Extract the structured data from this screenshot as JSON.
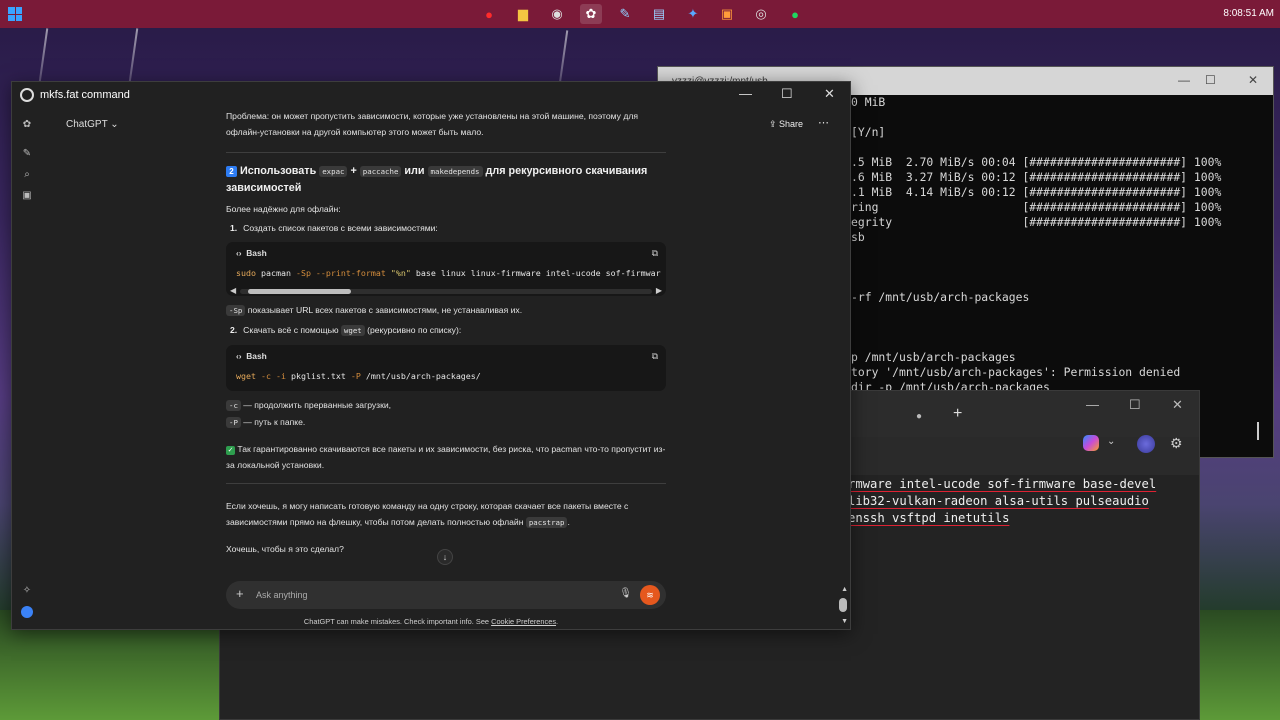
{
  "taskbar": {
    "clock": "8:08:51 AM",
    "icons": [
      "opera-icon",
      "files-icon",
      "obs-icon",
      "chatgpt-icon",
      "paint-icon",
      "notes-icon",
      "vs-icon",
      "office-icon",
      "chrome-icon",
      "spotify-icon"
    ]
  },
  "terminal1": {
    "title": "vzzzi@vzzzi:/mnt/usb",
    "lines": [
      "0 MiB",
      "",
      "[Y/n]",
      "",
      ".5 MiB  2.70 MiB/s 00:04 [######################] 100%",
      ".6 MiB  3.27 MiB/s 00:12 [######################] 100%",
      ".1 MiB  4.14 MiB/s 00:12 [######################] 100%",
      "ring                     [######################] 100%",
      "egrity                   [######################] 100%",
      "sb",
      "",
      "",
      "",
      "-rf /mnt/usb/arch-packages",
      "",
      "",
      "",
      "p /mnt/usb/arch-packages",
      "tory '/mnt/usb/arch-packages': Permission denied",
      "dir -p /mnt/usb/arch-packages"
    ]
  },
  "terminal2": {
    "lines": [
      "rmware intel-ucode sof-firmware base-devel",
      "lib32-vulkan-radeon alsa-utils pulseaudio",
      "enssh vsftpd inetutils"
    ]
  },
  "chatgpt": {
    "window_title": "mkfs.fat command",
    "model": "ChatGPT",
    "share_label": "Share",
    "top_text": "Проблема: он может пропустить зависимости, которые уже установлены на этой машине, поэтому для офлайн-установки на другой компьютер этого может быть мало.",
    "section_num": "2",
    "section_title_pre": "Использовать",
    "section_code1": "expac",
    "section_plus": "+",
    "section_code2": "paccache",
    "section_or": "или",
    "section_code3": "makedepends",
    "section_title_post": "для рекурсивного скачивания зависимостей",
    "reliable": "Более надёжно для офлайн:",
    "step1_num": "1.",
    "step1": "Создать список пакетов с всеми зависимостями:",
    "bash_label": "Bash",
    "code1_cmd": "sudo",
    "code1_rest": " pacman ",
    "code1_flag": "-Sp --print-format",
    "code1_str": " \"%n\"",
    "code1_tail": " base linux linux-firmware intel-ucode sof-firmwar",
    "sp_code": "-Sp",
    "sp_text": "показывает URL всех пакетов с зависимостями, не устанавливая их.",
    "step2_num": "2.",
    "step2_pre": "Скачать всё с помощью",
    "step2_code": "wget",
    "step2_post": "(рекурсивно по списку):",
    "code2_cmd": "wget",
    "code2_flag1": " -c -i",
    "code2_mid": " pkglist.txt ",
    "code2_flag2": "-P",
    "code2_tail": " /mnt/usb/arch-packages/",
    "c_code": "-c",
    "c_text": "— продолжить прерванные загрузки,",
    "p_code": "-P",
    "p_text": "— путь к папке.",
    "check_text": "Так гарантированно скачиваются все пакеты и их зависимости, без риска, что pacman что-то пропустит из-за локальной установки.",
    "offer_text": "Если хочешь, я могу написать готовую команду на одну строку, которая скачает все пакеты вместе с зависимостями прямо на флешку, чтобы потом делать полностью офлайн",
    "offer_code": "pacstrap",
    "offer_end": ".",
    "question": "Хочешь, чтобы я это сделал?",
    "input_placeholder": "Ask anything",
    "footer_text": "ChatGPT can make mistakes. Check important info. See",
    "footer_link": "Cookie Preferences",
    "footer_end": "."
  },
  "colors": {
    "taskbar": "#7a1a38",
    "accent_voice": "#e5581e",
    "check": "#2e9e4e",
    "num_badge": "#2d7cf3"
  }
}
